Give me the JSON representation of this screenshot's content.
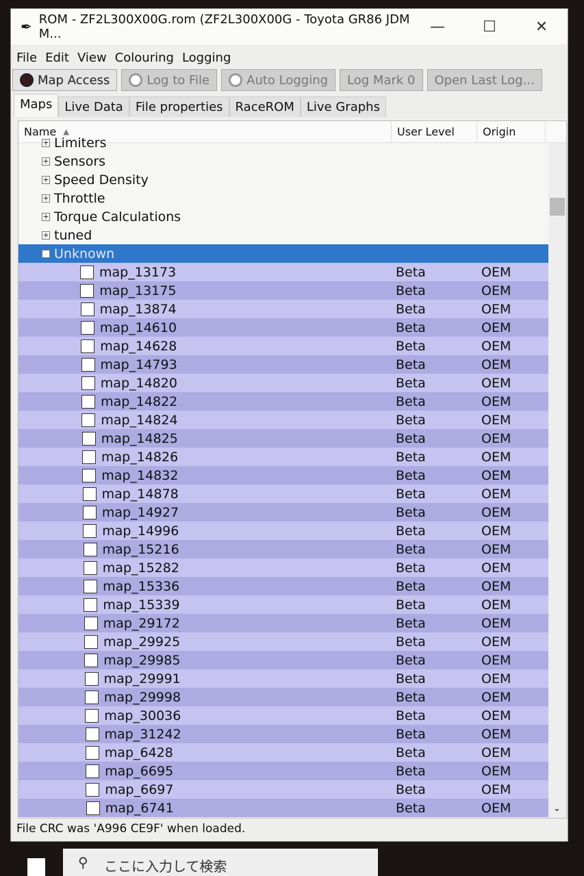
{
  "window": {
    "title": "ROM - ZF2L300X00G.rom (ZF2L300X00G - Toyota GR86 JDM M...",
    "minimize": "—",
    "maximize": "☐",
    "close": "✕"
  },
  "menu": [
    "File",
    "Edit",
    "View",
    "Colouring",
    "Logging"
  ],
  "toolbar": [
    {
      "label": "Map Access",
      "active": true
    },
    {
      "label": "Log to File",
      "active": false
    },
    {
      "label": "Auto Logging",
      "active": false
    },
    {
      "label": "Log Mark 0",
      "active": false
    },
    {
      "label": "Open Last Log...",
      "active": false
    }
  ],
  "tabs": [
    "Maps",
    "Live Data",
    "File properties",
    "RaceROM",
    "Live Graphs"
  ],
  "columns": {
    "name": "Name",
    "user_level": "User Level",
    "origin": "Origin"
  },
  "groups": [
    "Limiters",
    "Sensors",
    "Speed Density",
    "Throttle",
    "Torque Calculations",
    "tuned"
  ],
  "selected_group": "Unknown",
  "maps": [
    "map_13173",
    "map_13175",
    "map_13874",
    "map_14610",
    "map_14628",
    "map_14793",
    "map_14820",
    "map_14822",
    "map_14824",
    "map_14825",
    "map_14826",
    "map_14832",
    "map_14878",
    "map_14927",
    "map_14996",
    "map_15216",
    "map_15282",
    "map_15336",
    "map_15339",
    "map_29172",
    "map_29925",
    "map_29985",
    "map_29991",
    "map_29998",
    "map_30036",
    "map_31242",
    "map_6428",
    "map_6695",
    "map_6697",
    "map_6741"
  ],
  "map_user_level": "Beta",
  "map_origin": "OEM",
  "status": "File CRC was 'A996 CE9F' when loaded.",
  "taskbar": {
    "search_placeholder": "ここに入力して検索"
  },
  "colors": {
    "selection": "#2f77c8",
    "row_light": "#c6c3f0",
    "row_dark": "#aeabe3"
  }
}
